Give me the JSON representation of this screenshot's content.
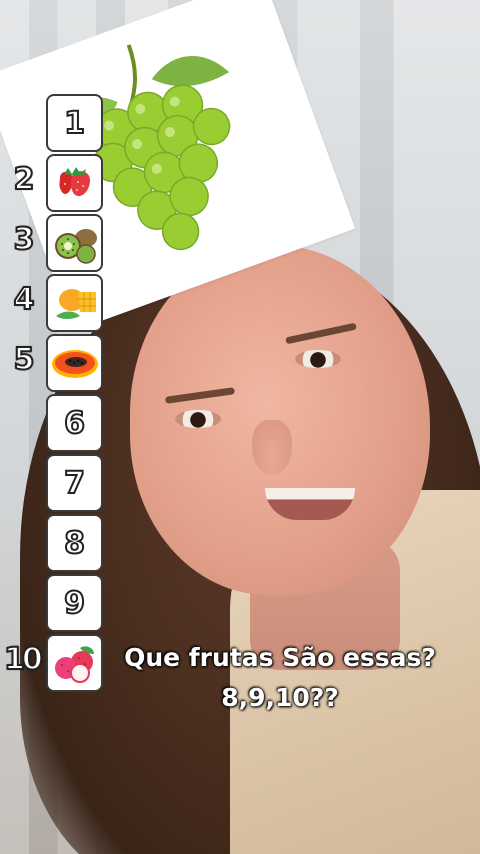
{
  "caption": {
    "line1": "Que frutas São essas?",
    "line2": "8,9,10??"
  },
  "featured_fruit": {
    "icon": "green-grapes-icon"
  },
  "ranking": [
    {
      "label": "",
      "box_text": "1",
      "icon": ""
    },
    {
      "label": "2",
      "box_text": "",
      "icon": "strawberry-icon"
    },
    {
      "label": "3",
      "box_text": "",
      "icon": "kiwi-icon"
    },
    {
      "label": "4",
      "box_text": "",
      "icon": "mango-icon"
    },
    {
      "label": "5",
      "box_text": "",
      "icon": "papaya-icon"
    },
    {
      "label": "",
      "box_text": "6",
      "icon": ""
    },
    {
      "label": "",
      "box_text": "7",
      "icon": ""
    },
    {
      "label": "",
      "box_text": "8",
      "icon": ""
    },
    {
      "label": "",
      "box_text": "9",
      "icon": ""
    },
    {
      "label": "10",
      "box_text": "",
      "icon": "lychee-icon"
    }
  ],
  "colors": {
    "caption_text": "#ffffff",
    "box_border": "#3a3a3a",
    "grape_green": "#8cc63f"
  }
}
